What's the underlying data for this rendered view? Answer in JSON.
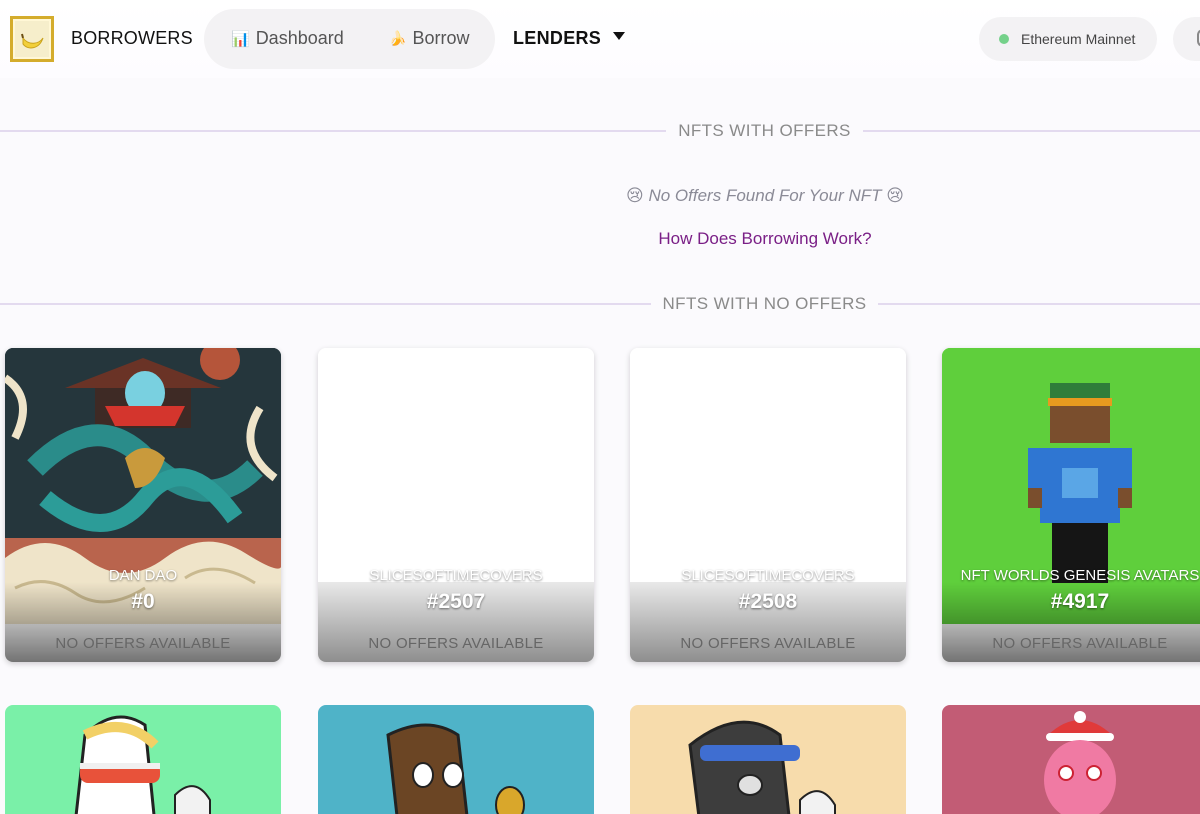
{
  "nav": {
    "brand": "BORROWERS",
    "links": [
      {
        "icon": "📊",
        "label": "Dashboard"
      },
      {
        "icon": "🍌",
        "label": "Borrow"
      }
    ],
    "lenders_label": "LENDERS",
    "network_label": "Ethereum Mainnet"
  },
  "sections": {
    "with_offers_title": "NFTS WITH OFFERS",
    "no_offers_message": "😢 No Offers Found For Your NFT 😢",
    "how_link": "How Does Borrowing Work?",
    "no_offers_title": "NFTS WITH NO OFFERS"
  },
  "cards": [
    {
      "collection": "DAN DAO",
      "token": "#0",
      "footer": "NO OFFERS AVAILABLE",
      "bg": "#2b3d45"
    },
    {
      "collection": "SLICESOFTIMECOVERS",
      "token": "#2507",
      "footer": "NO OFFERS AVAILABLE",
      "bg": "#ffffff"
    },
    {
      "collection": "SLICESOFTIMECOVERS",
      "token": "#2508",
      "footer": "NO OFFERS AVAILABLE",
      "bg": "#ffffff"
    },
    {
      "collection": "NFT WORLDS GENESIS AVATARS",
      "token": "#4917",
      "footer": "NO OFFERS AVAILABLE",
      "bg": "#5fcf3c"
    }
  ],
  "row2_colors": [
    "#7af0a8",
    "#4fb3c8",
    "#f7dcac",
    "#c25c75"
  ]
}
